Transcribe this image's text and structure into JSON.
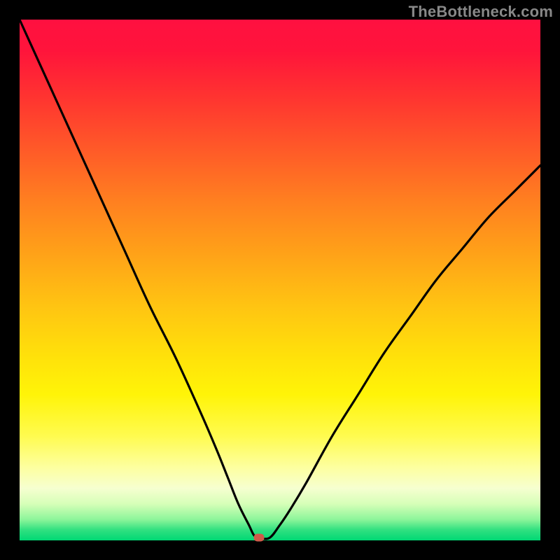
{
  "watermark": "TheBottleneck.com",
  "colors": {
    "frame": "#000000",
    "curve": "#000000",
    "marker": "#cf5a4a",
    "gradient_top": "#ff1040",
    "gradient_bottom": "#00d874"
  },
  "chart_data": {
    "type": "line",
    "title": "",
    "xlabel": "",
    "ylabel": "",
    "xlim": [
      0,
      100
    ],
    "ylim": [
      0,
      100
    ],
    "series": [
      {
        "name": "bottleneck-curve",
        "x": [
          0,
          5,
          10,
          15,
          20,
          25,
          30,
          35,
          38,
          40,
          42,
          44,
          45,
          46,
          48,
          50,
          52,
          55,
          60,
          65,
          70,
          75,
          80,
          85,
          90,
          95,
          100
        ],
        "y": [
          100,
          89,
          78,
          67,
          56,
          45,
          35,
          24,
          17,
          12,
          7,
          3,
          1,
          0.5,
          0.5,
          3,
          6,
          11,
          20,
          28,
          36,
          43,
          50,
          56,
          62,
          67,
          72
        ]
      }
    ],
    "annotations": [
      {
        "name": "min-marker",
        "x": 46,
        "y": 0.5
      }
    ]
  }
}
